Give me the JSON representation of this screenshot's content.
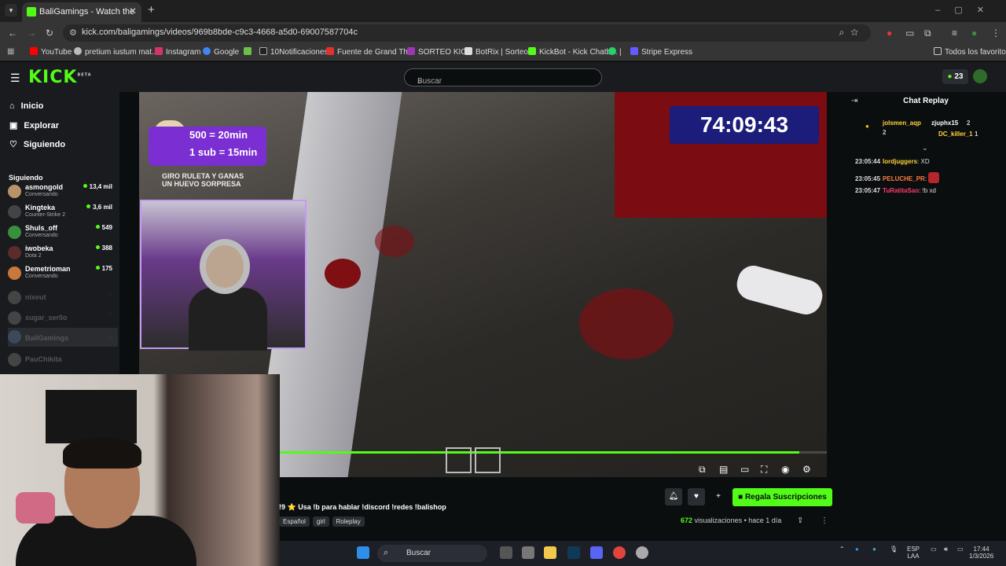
{
  "browser": {
    "tab_title": "BaliGamings - Watch the VOD c",
    "url": "kick.com/baligamings/videos/969b8bde-c9c3-4668-a5d0-69007587704c",
    "bookmarks": [
      "YouTube",
      "pretium iustum mat...",
      "Instagram",
      "Google",
      "10Notificaciones",
      "Fuente de Grand Th...",
      "SORTEO KICK",
      "BotRix | Sorteos",
      "KickBot - Kick Chatb...",
      "|",
      "Stripe Express"
    ],
    "all_bookmarks": "Todos los favoritos"
  },
  "header": {
    "logo": "KICK",
    "logo_badge": "BETA",
    "search_placeholder": "Buscar",
    "points": "23"
  },
  "sidebar": {
    "nav": [
      {
        "icon": "home-icon",
        "label": "Inicio"
      },
      {
        "icon": "compass-icon",
        "label": "Explorar"
      },
      {
        "icon": "heart-icon",
        "label": "Siguiendo"
      }
    ],
    "following_title": "Siguiendo",
    "following": [
      {
        "name": "asmongold",
        "category": "Conversando",
        "viewers": "13,4 mil",
        "live": true
      },
      {
        "name": "Kingteka",
        "category": "Counter-Strike 2",
        "viewers": "3,6 mil",
        "live": true
      },
      {
        "name": "Shuls_off",
        "category": "Conversando",
        "viewers": "549",
        "live": true
      },
      {
        "name": "iwobeka",
        "category": "Dota 2",
        "viewers": "388",
        "live": true
      },
      {
        "name": "Demetrioman",
        "category": "Conversando",
        "viewers": "175",
        "live": true
      },
      {
        "name": "nixeut",
        "category": "",
        "viewers": "",
        "live": false
      },
      {
        "name": "sugar_ser0o",
        "category": "",
        "viewers": "",
        "live": false
      },
      {
        "name": "BaliGamings",
        "category": "",
        "viewers": "",
        "live": false
      },
      {
        "name": "PauChikita",
        "category": "",
        "viewers": "",
        "live": false
      }
    ]
  },
  "video": {
    "timer": "74:09:43",
    "promo_line1": "500 = 20min",
    "promo_line2": "1 sub = 15min",
    "promo_caption_1": "GIRO RULETA Y GANAS",
    "promo_caption_2": "UN HUEVO SORPRESA",
    "progress": 0.96
  },
  "video_info": {
    "title": "!9 ⭐ Usa !b para hablar !discord !redes !balishop",
    "tags": [
      "Español",
      "girl",
      "Roleplay"
    ],
    "views_count": "672",
    "views_label": "visualizaciones",
    "age": "hace 1 día",
    "gift_button": "Regala Suscripciones"
  },
  "chat": {
    "title": "Chat Replay",
    "pinned": [
      {
        "name": "jolsmen_aqp",
        "count": "2"
      },
      {
        "name": "zjuphx15",
        "count": "2"
      },
      {
        "name": "DC_killer_1",
        "count": "1"
      }
    ],
    "messages": [
      {
        "time": "23:05:44",
        "user": "lordjuggers",
        "color": "#ffd43b",
        "text": ": XD"
      },
      {
        "time": "23:05:45",
        "user": "PELUCHE_PR",
        "color": "#ff7a3d",
        "text": ":"
      },
      {
        "time": "23:05:47",
        "user": "TuRatitaSao",
        "color": "#ff3d6e",
        "text": ": !b xd"
      }
    ]
  },
  "taskbar": {
    "search": "Buscar",
    "lang": "ESP",
    "lang2": "LAA",
    "time": "17:44",
    "date": "1/3/2026"
  },
  "colors": {
    "accent": "#53fc18",
    "bg": "#0b0e0f",
    "panel": "#191b1f"
  }
}
